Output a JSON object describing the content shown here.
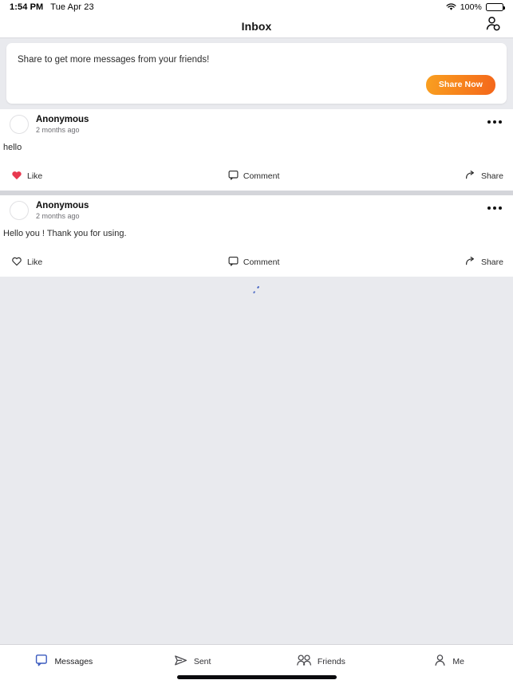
{
  "status_bar": {
    "time": "1:54 PM",
    "date": "Tue Apr 23",
    "battery_percent": "100%",
    "wifi_icon": "wifi-icon",
    "battery_icon": "battery-full-icon"
  },
  "nav": {
    "title": "Inbox",
    "action_icon": "add-person-icon"
  },
  "banner": {
    "text": "Share to get more messages from your friends!",
    "button_label": "Share Now",
    "button_gradient_from": "#f9a021",
    "button_gradient_to": "#f4661b"
  },
  "posts": [
    {
      "author": "Anonymous",
      "time": "2 months ago",
      "body": "hello",
      "liked": true,
      "like_label": "Like",
      "comment_label": "Comment",
      "share_label": "Share",
      "like_color": "#e8384f"
    },
    {
      "author": "Anonymous",
      "time": "2 months ago",
      "body": "Hello you ! Thank you for using.",
      "liked": false,
      "like_label": "Like",
      "comment_label": "Comment",
      "share_label": "Share",
      "like_color": "#2b2b2b"
    }
  ],
  "loading": {
    "spinner_color": "#3b5bbf",
    "visible": true
  },
  "tabbar": {
    "active_index": 0,
    "active_color": "#3b5bbf",
    "inactive_color": "#4a4a4f",
    "items": [
      {
        "label": "Messages",
        "icon": "messages-bubble-icon"
      },
      {
        "label": "Sent",
        "icon": "paper-plane-icon"
      },
      {
        "label": "Friends",
        "icon": "two-people-icon"
      },
      {
        "label": "Me",
        "icon": "person-icon"
      }
    ]
  }
}
